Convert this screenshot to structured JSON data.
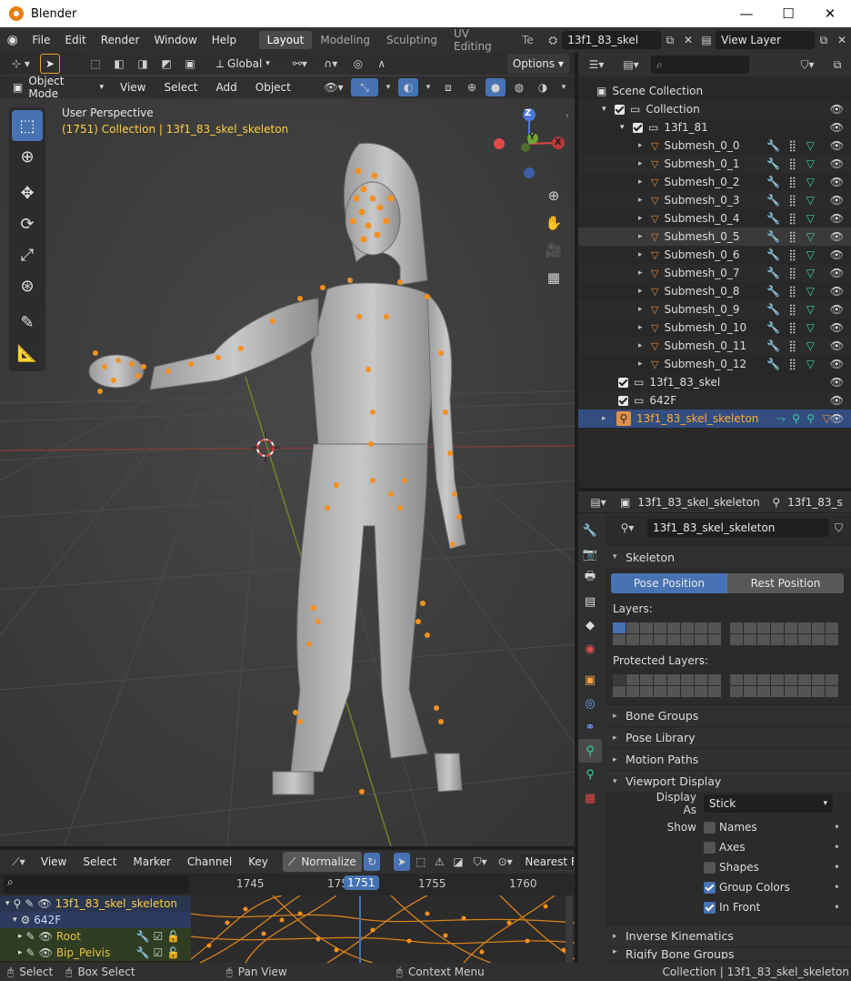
{
  "window": {
    "title": "Blender",
    "minimize": "—",
    "maximize": "☐",
    "close": "✕"
  },
  "menu": {
    "items": [
      "File",
      "Edit",
      "Render",
      "Window",
      "Help"
    ]
  },
  "workspaces": {
    "tabs": [
      "Layout",
      "Modeling",
      "Sculpting",
      "UV Editing",
      "Te"
    ],
    "active": "Layout"
  },
  "scene_field": "13f1_83_skel",
  "view_layer_field": "View Layer",
  "viewport": {
    "header": {
      "transform_orientation": "Global",
      "options": "Options",
      "mode": "Object Mode",
      "menus": [
        "View",
        "Select",
        "Add",
        "Object"
      ]
    },
    "overlay_info": {
      "perspective": "User Perspective",
      "collection_info": "(1751) Collection | 13f1_83_skel_skeleton"
    },
    "gizmo": {
      "z": "Z",
      "x": "X",
      "y": "Y"
    }
  },
  "outliner": {
    "scene_collection": "Scene Collection",
    "collection": "Collection",
    "group": "13f1_81",
    "submeshes": [
      "Submesh_0_0",
      "Submesh_0_1",
      "Submesh_0_2",
      "Submesh_0_3",
      "Submesh_0_4",
      "Submesh_0_5",
      "Submesh_0_6",
      "Submesh_0_7",
      "Submesh_0_8",
      "Submesh_0_9",
      "Submesh_0_10",
      "Submesh_0_11",
      "Submesh_0_12"
    ],
    "highlighted": "Submesh_0_5",
    "others": [
      "13f1_83_skel",
      "642F"
    ],
    "selected": "13f1_83_skel_skeleton"
  },
  "properties": {
    "tabs_header": {
      "object": "13f1_83_skel_skeleton",
      "data": "13f1_83_s"
    },
    "armature_name": "13f1_83_skel_skeleton",
    "skeleton_panel": "Skeleton",
    "pose_position": "Pose Position",
    "rest_position": "Rest Position",
    "layers_label": "Layers:",
    "protected_layers_label": "Protected Layers:",
    "collapsed_panels": [
      "Bone Groups",
      "Pose Library",
      "Motion Paths"
    ],
    "viewport_display": "Viewport Display",
    "display_as_label": "Display As",
    "display_as_value": "Stick",
    "show_label": "Show",
    "show_options": [
      {
        "label": "Names",
        "checked": false
      },
      {
        "label": "Axes",
        "checked": false
      },
      {
        "label": "Shapes",
        "checked": false
      },
      {
        "label": "Group Colors",
        "checked": true
      },
      {
        "label": "In Front",
        "checked": true
      }
    ],
    "inverse_kinematics": "Inverse Kinematics",
    "rigify": "Rigify Bone Groups"
  },
  "dopesheet": {
    "menus": [
      "View",
      "Select",
      "Marker",
      "Channel",
      "Key"
    ],
    "normalize": "Normalize",
    "snapping": "Nearest Fra",
    "frames": [
      "1745",
      "175",
      "1755",
      "1760"
    ],
    "current_frame": "1751",
    "channels": [
      {
        "name": "13f1_83_skel_skeleton",
        "color": "#ffcf40"
      },
      {
        "name": "642F",
        "color": "#cfd6ff"
      },
      {
        "name": "Root",
        "color": "#e8c238"
      },
      {
        "name": "Bip_Pelvis",
        "color": "#e8c238"
      }
    ]
  },
  "status": {
    "select": "Select",
    "box_select": "Box Select",
    "pan_view": "Pan View",
    "context_menu": "Context Menu",
    "info": "Collection | 13f1_83_skel_skeleton"
  },
  "colors": {
    "accent": "#4772b3",
    "selection": "#ffa62b",
    "active_object": "#ffae29",
    "bone_dots": "#f39020"
  }
}
